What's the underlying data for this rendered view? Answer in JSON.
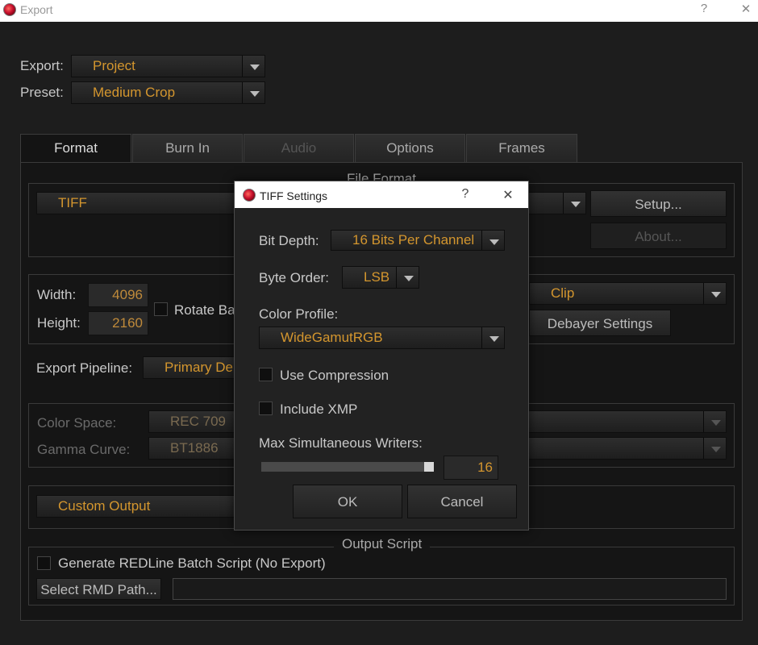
{
  "window": {
    "title": "Export",
    "help": "?",
    "close": "✕"
  },
  "export": {
    "label": "Export:",
    "value": "Project"
  },
  "preset": {
    "label": "Preset:",
    "value": "Medium Crop"
  },
  "tabs": [
    {
      "label": "Format",
      "state": "active"
    },
    {
      "label": "Burn In",
      "state": "normal"
    },
    {
      "label": "Audio",
      "state": "disabled"
    },
    {
      "label": "Options",
      "state": "normal"
    },
    {
      "label": "Frames",
      "state": "normal"
    }
  ],
  "file_format": {
    "legend": "File Format",
    "value": "TIFF",
    "setup": "Setup...",
    "about": "About..."
  },
  "size": {
    "width_label": "Width:",
    "width_value": "4096",
    "height_label": "Height:",
    "height_value": "2160",
    "rotate_label": "Rotate Ba",
    "clip_value": "Clip",
    "debayer": "Debayer Settings"
  },
  "pipeline": {
    "label": "Export Pipeline:",
    "value": "Primary De"
  },
  "color": {
    "space_label": "Color Space:",
    "space_value": "REC 709",
    "gamma_label": "Gamma Curve:",
    "gamma_value": "BT1886"
  },
  "output": {
    "value": "Custom Output"
  },
  "script": {
    "legend": "Output Script",
    "checkbox_label": "Generate REDLine Batch Script (No Export)",
    "rmd_button": "Select RMD Path..."
  },
  "dialog": {
    "title": "TIFF Settings",
    "help": "?",
    "close": "✕",
    "bit_depth_label": "Bit Depth:",
    "bit_depth_value": "16 Bits Per Channel",
    "byte_order_label": "Byte Order:",
    "byte_order_value": "LSB",
    "color_profile_label": "Color Profile:",
    "color_profile_value": "WideGamutRGB",
    "use_compression": "Use Compression",
    "include_xmp": "Include XMP",
    "writers_label": "Max Simultaneous Writers:",
    "writers_value": "16",
    "writers_fraction": 1.0,
    "ok": "OK",
    "cancel": "Cancel"
  }
}
